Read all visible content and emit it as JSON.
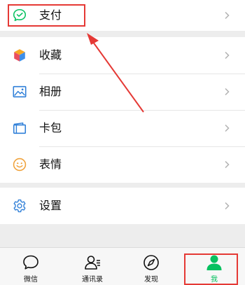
{
  "menu": {
    "payment": "支付",
    "favorites": "收藏",
    "album": "相册",
    "cards": "卡包",
    "stickers": "表情",
    "settings": "设置"
  },
  "tabbar": {
    "chats": "微信",
    "contacts": "通讯录",
    "discover": "发现",
    "me": "我"
  },
  "colors": {
    "accent": "#07c160",
    "highlight": "#e53935",
    "background": "#ededed"
  }
}
